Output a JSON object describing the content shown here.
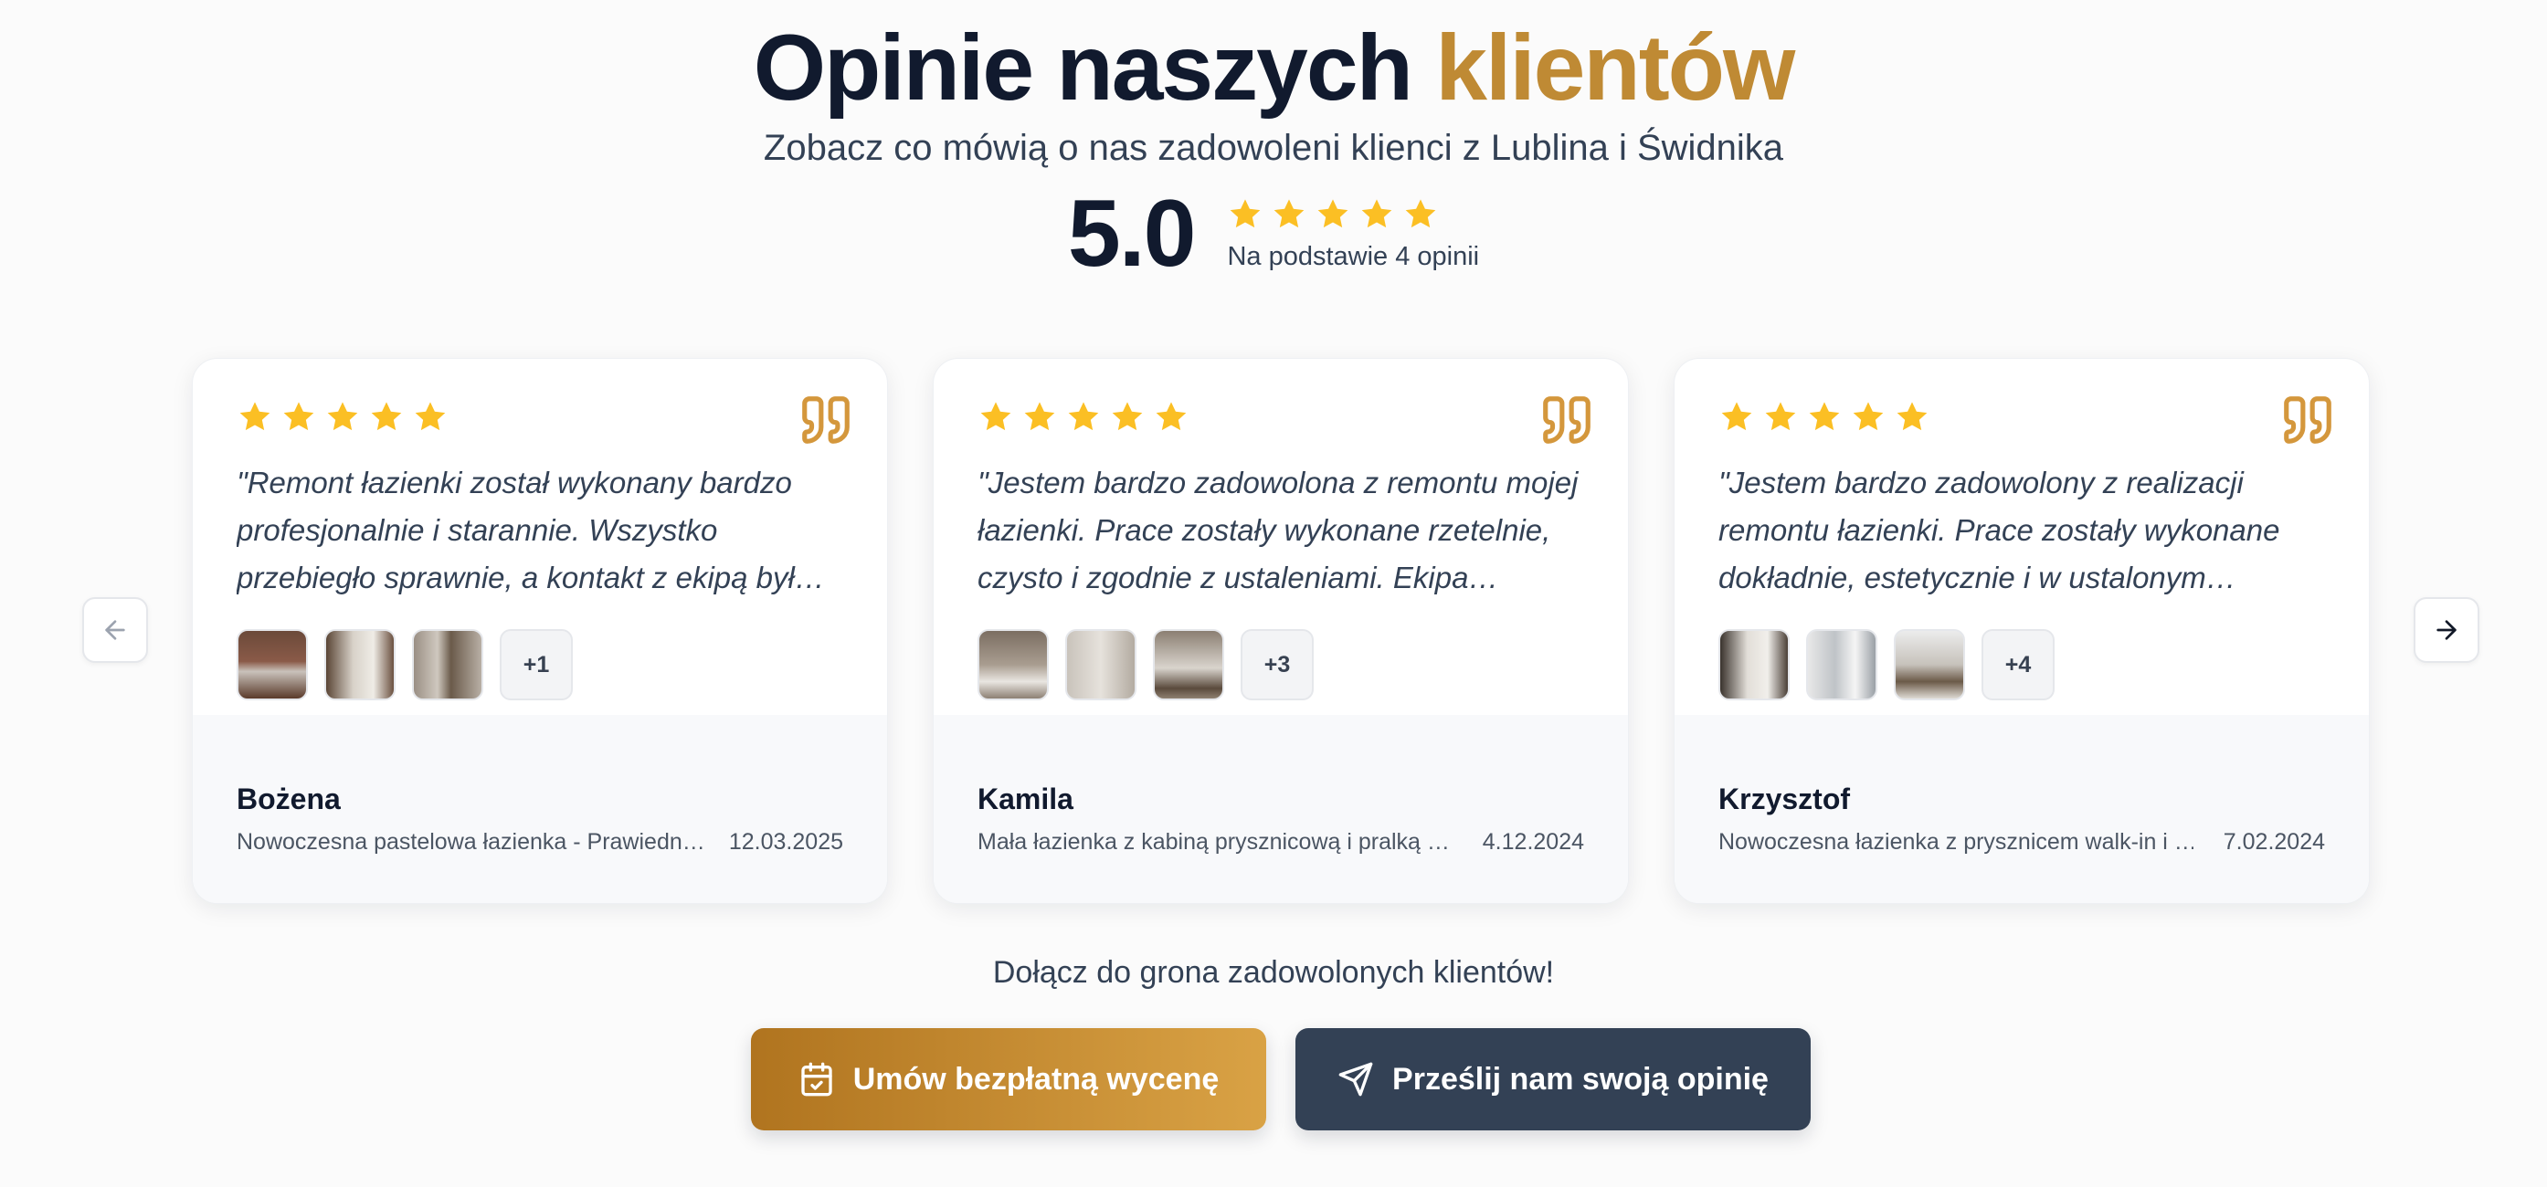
{
  "header": {
    "title_main": "Opinie naszych ",
    "title_accent": "klientów",
    "subtitle": "Zobacz co mówią o nas zadowoleni klienci z Lublina i Świdnika",
    "score": "5.0",
    "stars": 5,
    "rating_caption": "Na podstawie 4 opinii"
  },
  "colors": {
    "accent": "#bf8a34",
    "star": "#fbbf24",
    "dark": "#334155"
  },
  "reviews": [
    {
      "stars": 5,
      "quote": "\"Remont łazienki został wykonany bardzo profesjonalnie i starannie. Wszystko przebiegło sprawnie, a kontakt z ekipą był…",
      "more_photos": "+1",
      "author": "Bożena",
      "project": "Nowoczesna pastelowa łazienka - Prawiedn…",
      "date": "12.03.2025"
    },
    {
      "stars": 5,
      "quote": "\"Jestem bardzo zadowolona z remontu mojej łazienki. Prace zostały wykonane rzetelnie, czysto i zgodnie z ustaleniami. Ekipa…",
      "more_photos": "+3",
      "author": "Kamila",
      "project": "Mała łazienka z kabiną prysznicową i pralką …",
      "date": "4.12.2024"
    },
    {
      "stars": 5,
      "quote": "\"Jestem bardzo zadowolony z realizacji remontu łazienki. Prace zostały wykonane dokładnie, estetycznie i w ustalonym…",
      "more_photos": "+4",
      "author": "Krzysztof",
      "project": "Nowoczesna łazienka z prysznicem walk-in i …",
      "date": "7.02.2024"
    }
  ],
  "cta": {
    "text": "Dołącz do grona zadowolonych klientów!",
    "quote_button": "Umów bezpłatną wycenę",
    "review_button": "Prześlij nam swoją opinię"
  },
  "icons": {
    "prev": "arrow-left-icon",
    "next": "arrow-right-icon",
    "calendar": "calendar-check-icon",
    "send": "send-icon",
    "quote": "quote-icon",
    "star": "star-icon"
  }
}
